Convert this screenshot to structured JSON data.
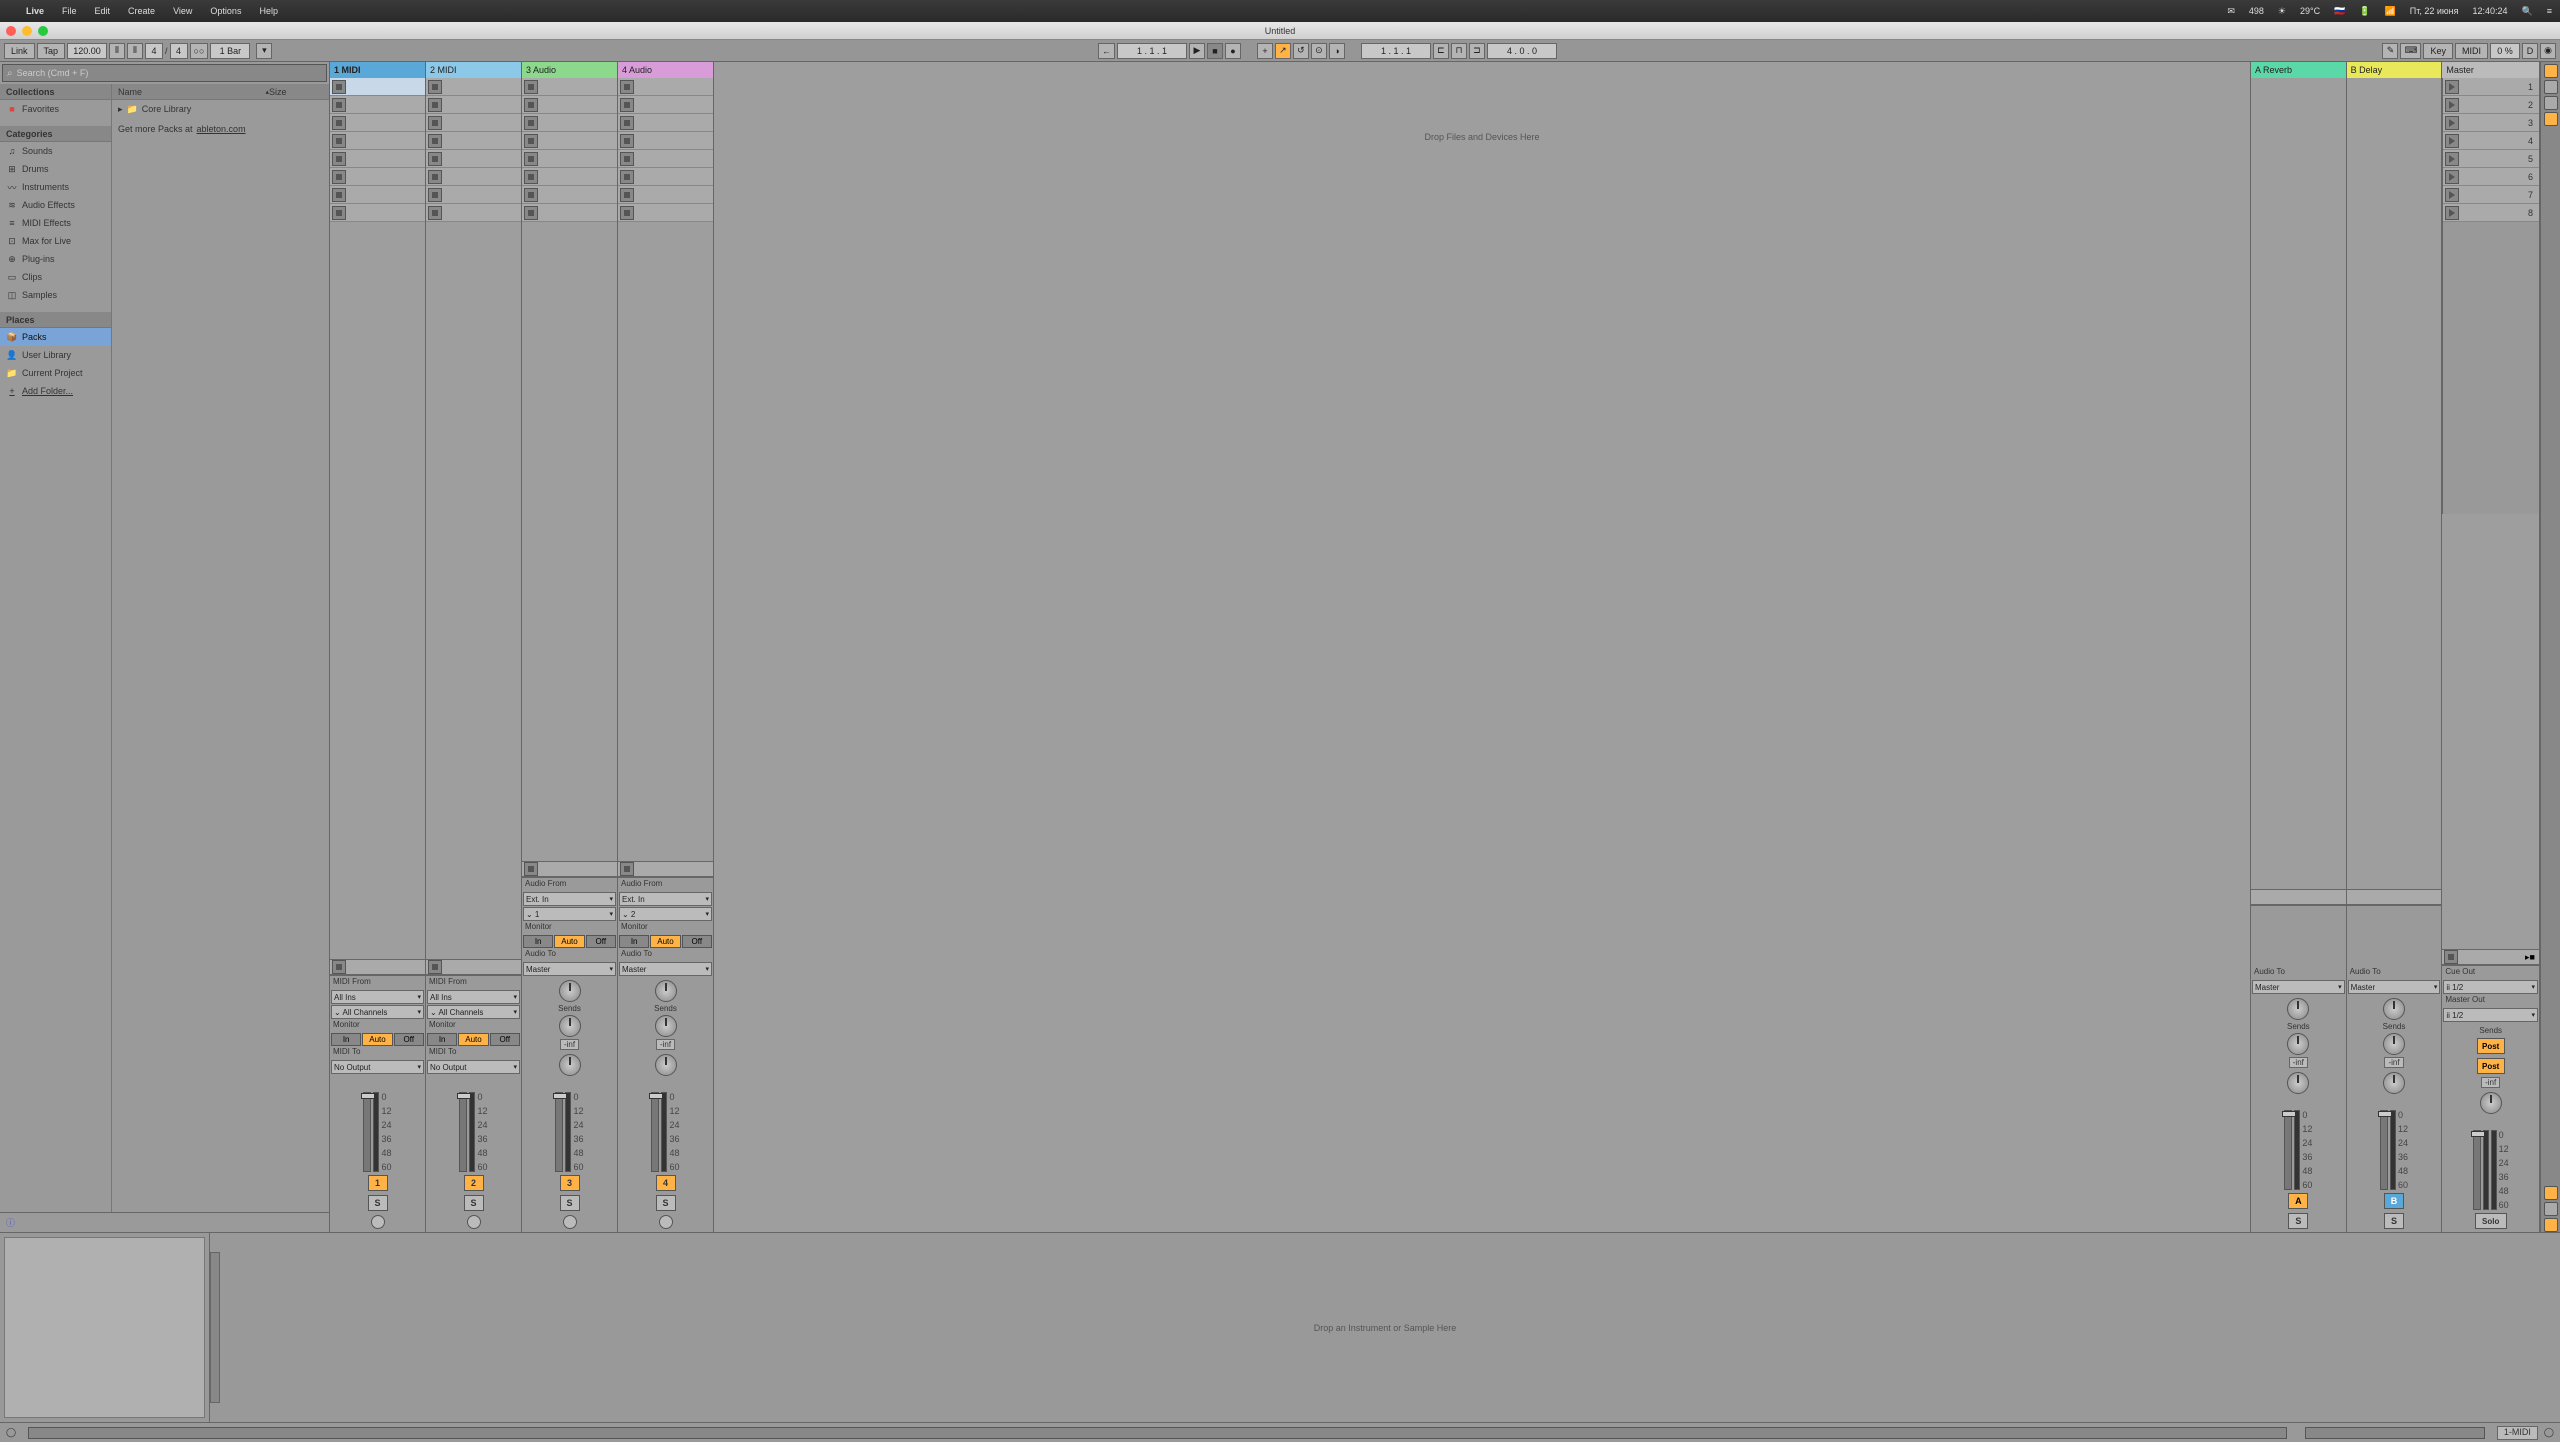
{
  "menubar": {
    "apple": "",
    "app": "Live",
    "items": [
      "File",
      "Edit",
      "Create",
      "View",
      "Options",
      "Help"
    ],
    "right": {
      "mail": "✉",
      "mail_count": "498",
      "weather": "☀",
      "temp": "29°C",
      "flag": "🇷🇺",
      "battery": "🔋",
      "wifi": "📶",
      "date": "Пт, 22 июня",
      "time": "12:40:24",
      "search": "🔍",
      "menu": "≡"
    }
  },
  "window": {
    "title": "Untitled"
  },
  "topbar": {
    "link": "Link",
    "tap": "Tap",
    "tempo": "120.00",
    "sig_num": "4",
    "sig_den": "4",
    "metro": "○○",
    "bar": "1 Bar",
    "follow": "←",
    "pos": "1 .  1 .  1",
    "play": "▶",
    "stop": "■",
    "rec": "●",
    "ovr": "+",
    "auto": "↗",
    "reen": "↺",
    "lloop": "[",
    "loop": "1 .  1 .  1",
    "punch": "⎆",
    "rloop": "]",
    "looplen": "4 .  0 .  0",
    "pencil": "✎",
    "kbd": "⌨",
    "key": "Key",
    "midi": "MIDI",
    "cpu": "0 %",
    "d": "D",
    "act": "◉"
  },
  "browser": {
    "search_ph": "Search (Cmd + F)",
    "collections": "Collections",
    "fav": "Favorites",
    "categories": "Categories",
    "cats": [
      {
        "i": "♫",
        "l": "Sounds"
      },
      {
        "i": "⊞",
        "l": "Drums"
      },
      {
        "i": "〰",
        "l": "Instruments"
      },
      {
        "i": "≋",
        "l": "Audio Effects"
      },
      {
        "i": "≡",
        "l": "MIDI Effects"
      },
      {
        "i": "⊡",
        "l": "Max for Live"
      },
      {
        "i": "⊕",
        "l": "Plug-ins"
      },
      {
        "i": "▭",
        "l": "Clips"
      },
      {
        "i": "◫",
        "l": "Samples"
      }
    ],
    "places": "Places",
    "pls": [
      {
        "i": "📦",
        "l": "Packs",
        "sel": true
      },
      {
        "i": "👤",
        "l": "User Library"
      },
      {
        "i": "📁",
        "l": "Current Project"
      },
      {
        "i": "+",
        "l": "Add Folder...",
        "u": true
      }
    ],
    "col_name": "Name",
    "col_size": "Size",
    "core": "Core Library",
    "packs_msg": "Get more Packs at ",
    "packs_link": "ableton.com",
    "info": "ⓘ"
  },
  "tracks": [
    {
      "name": "1 MIDI",
      "color": "c-midi1",
      "sel": true,
      "type": "midi",
      "from": "MIDI From",
      "in": "All Ins",
      "ch": "⌄ All Channels",
      "mon": "Monitor",
      "to": "MIDI To",
      "out": "No Output",
      "num": "1"
    },
    {
      "name": "2 MIDI",
      "color": "c-midi2",
      "type": "midi",
      "from": "MIDI From",
      "in": "All Ins",
      "ch": "⌄ All Channels",
      "mon": "Monitor",
      "to": "MIDI To",
      "out": "No Output",
      "num": "2"
    },
    {
      "name": "3 Audio",
      "color": "c-audio1",
      "type": "audio",
      "from": "Audio From",
      "in": "Ext. In",
      "ch": "⌄ 1",
      "mon": "Monitor",
      "to": "Audio To",
      "out": "Master",
      "num": "3"
    },
    {
      "name": "4 Audio",
      "color": "c-audio2",
      "type": "audio",
      "from": "Audio From",
      "in": "Ext. In",
      "ch": "⌄ 2",
      "mon": "Monitor",
      "to": "Audio To",
      "out": "Master",
      "num": "4"
    }
  ],
  "returns": [
    {
      "name": "A Reverb",
      "color": "c-reverb",
      "to": "Audio To",
      "out": "Master",
      "letter": "A",
      "btncls": "a"
    },
    {
      "name": "B Delay",
      "color": "c-delay",
      "to": "Audio To",
      "out": "Master",
      "letter": "B",
      "btncls": "b"
    }
  ],
  "master": {
    "name": "Master",
    "color": "c-master",
    "cue": "Cue Out",
    "cueout": "ii 1/2",
    "mout_lbl": "Master Out",
    "mout": "ii 1/2",
    "post": "Post",
    "solo": "Solo"
  },
  "scenes": [
    "1",
    "2",
    "3",
    "4",
    "5",
    "6",
    "7",
    "8"
  ],
  "mon": {
    "in": "In",
    "auto": "Auto",
    "off": "Off"
  },
  "mixer": {
    "sends": "Sends",
    "inf": "-inf",
    "dbs": [
      "0",
      "12",
      "24",
      "36",
      "48",
      "60"
    ]
  },
  "drop_main": "Drop Files and Devices Here",
  "drop_detail": "Drop an Instrument or Sample Here",
  "status": {
    "sel": "1-MIDI",
    "circle": "◯"
  }
}
